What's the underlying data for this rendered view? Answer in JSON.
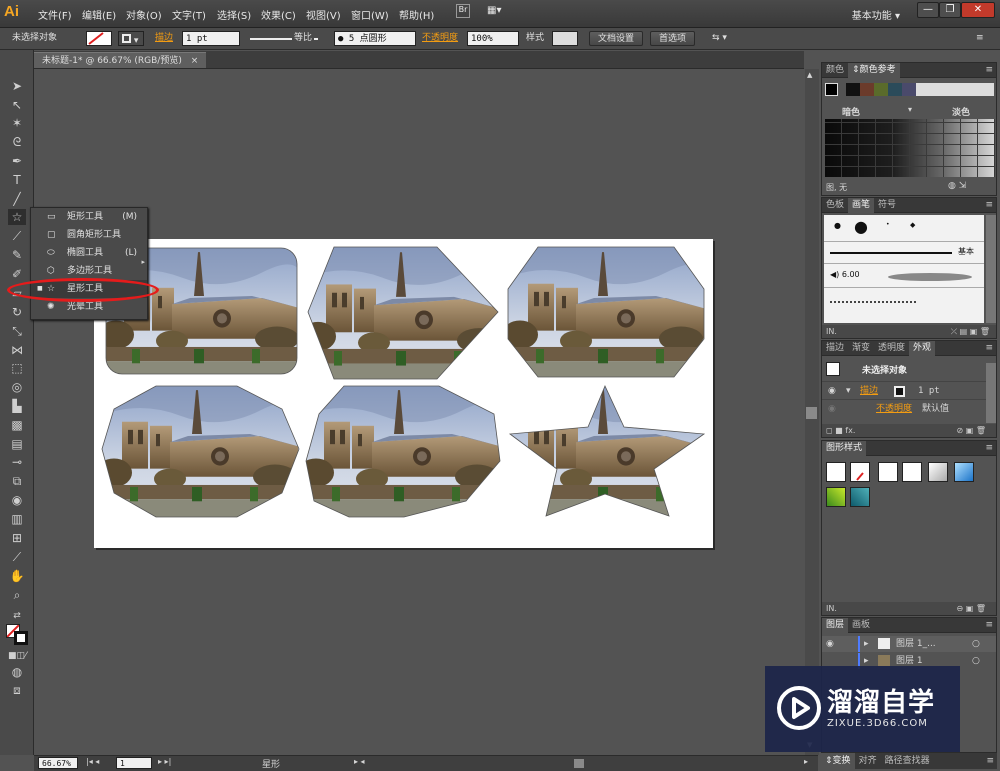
{
  "app_logo": "Ai",
  "menus": [
    "文件(F)",
    "编辑(E)",
    "对象(O)",
    "文字(T)",
    "选择(S)",
    "效果(C)",
    "视图(V)",
    "窗口(W)",
    "帮助(H)"
  ],
  "workspace": "基本功能",
  "control_bar": {
    "selection": "未选择对象",
    "stroke_label": "描边",
    "stroke_weight": "1 pt",
    "stroke_profile": "等比",
    "brush": "● 5 点圆形",
    "opacity_label": "不透明度",
    "opacity_value": "100%",
    "style_label": "样式",
    "doc_setup": "文档设置",
    "preferences": "首选项"
  },
  "document_tab": "未标题-1* @ 66.67% (RGB/预览)",
  "flyout": {
    "items": [
      {
        "label": "矩形工具",
        "key": "(M)"
      },
      {
        "label": "圆角矩形工具",
        "key": ""
      },
      {
        "label": "椭圆工具",
        "key": "(L)"
      },
      {
        "label": "多边形工具",
        "key": ""
      },
      {
        "label": "星形工具",
        "key": ""
      },
      {
        "label": "光晕工具",
        "key": ""
      }
    ]
  },
  "artboard": {
    "shapes": [
      "rounded-rectangle",
      "hexagon",
      "octagon",
      "decagon",
      "nonagon",
      "star"
    ],
    "photo": "cathedral-photo"
  },
  "panels": {
    "color": {
      "tabs": [
        "颜色",
        "颜色参考"
      ],
      "dark_label": "暗色",
      "light_label": "淡色",
      "none_label": "无"
    },
    "brushes": {
      "tabs": [
        "色板",
        "画笔",
        "符号"
      ],
      "basic_label": "基本",
      "size_label": "6.00"
    },
    "appearance": {
      "tabs": [
        "描边",
        "渐变",
        "透明度",
        "外观"
      ],
      "title": "未选择对象",
      "stroke_label": "描边",
      "stroke_value": "1 pt",
      "opacity_label": "不透明度",
      "opacity_value": "默认值"
    },
    "graphic_styles": {
      "tabs": [
        "图形样式"
      ]
    },
    "layers": {
      "tabs": [
        "图层",
        "画板"
      ],
      "rows": [
        "图层 1_...",
        "图层 1"
      ]
    },
    "bottom_tabs": [
      "变换",
      "对齐",
      "路径查找器"
    ]
  },
  "status": {
    "zoom": "66.67%",
    "page": "1",
    "tool": "星形"
  },
  "watermark": {
    "title": "溜溜自学",
    "url": "ZIXUE.3D66.COM"
  },
  "colors": {
    "accent": "#f39c12",
    "highlight_oval": "#e51b1b",
    "chrome": "#4a4a4a",
    "watermark_bg": "#1c254a"
  }
}
